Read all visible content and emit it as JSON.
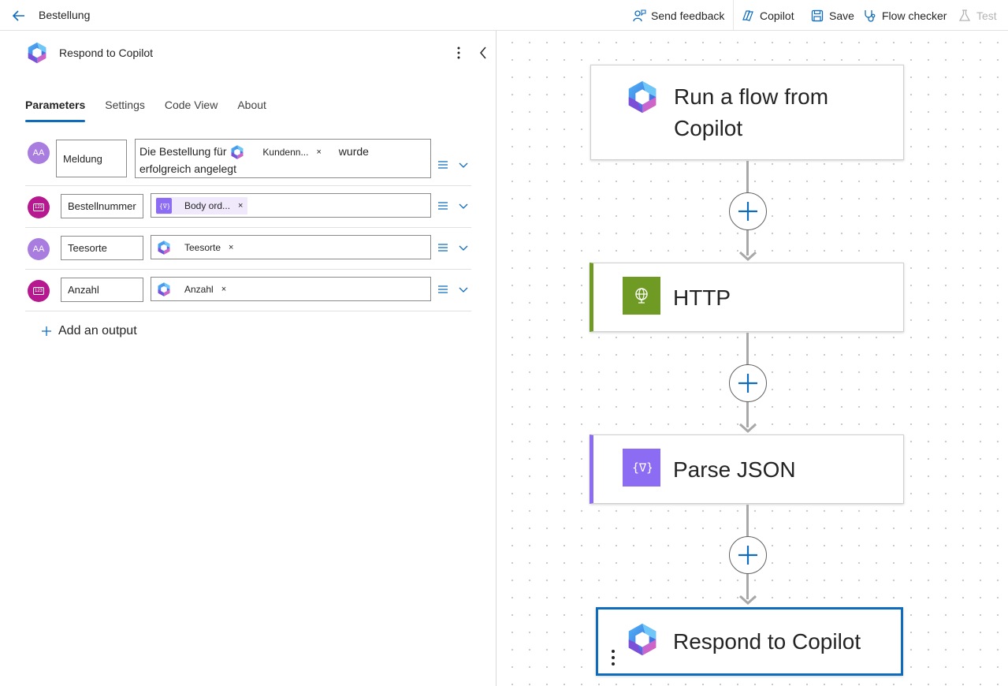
{
  "topbar": {
    "title": "Bestellung",
    "send_feedback": "Send feedback",
    "copilot": "Copilot",
    "save": "Save",
    "flow_checker": "Flow checker",
    "test": "Test"
  },
  "panel": {
    "title": "Respond to Copilot",
    "tabs": [
      "Parameters",
      "Settings",
      "Code View",
      "About"
    ],
    "active_tab": "Parameters",
    "rows": [
      {
        "type": "text",
        "avatar": "AA",
        "name": "Meldung",
        "value_prefix": "Die Bestellung für",
        "token": "Kundenn...",
        "token_close": "×",
        "value_suffix": "wurde",
        "value_line2": "erfolgreich angelegt"
      },
      {
        "type": "number",
        "avatar": "123",
        "name": "Bestellnummer",
        "token": "Body ord...",
        "token_close": "×"
      },
      {
        "type": "text",
        "avatar": "AA",
        "name": "Teesorte",
        "token": "Teesorte",
        "token_close": "×"
      },
      {
        "type": "number",
        "avatar": "123",
        "name": "Anzahl",
        "token": "Anzahl",
        "token_close": "×"
      }
    ],
    "add_output": "Add an output"
  },
  "canvas": {
    "cards": [
      {
        "title_line1": "Run a flow from",
        "title_line2": "Copilot",
        "icon": "copilot-logo-icon"
      },
      {
        "title": "HTTP",
        "icon": "globe-icon",
        "accent": "#6f9a24"
      },
      {
        "title": "Parse JSON",
        "icon": "braces-icon",
        "accent": "#8c6cf3"
      },
      {
        "title": "Respond to Copilot",
        "icon": "copilot-logo-icon",
        "selected_border": "#0f6cbd"
      }
    ]
  },
  "colors": {
    "accent_blue": "#0f6cbd",
    "http_green": "#6f9a24",
    "parse_purple": "#8c6cf3",
    "text_avatar": "#a97de0",
    "number_avatar": "#b5188f"
  }
}
